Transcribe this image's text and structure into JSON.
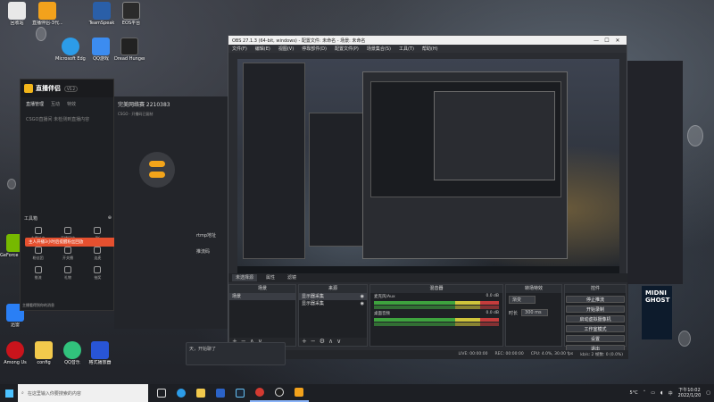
{
  "desktop_icons": [
    {
      "label": "回收站",
      "color": "#ffffff"
    },
    {
      "label": "直播伴侣-3代...",
      "color": "#f3a21c"
    },
    {
      "label": "TeamSpeak",
      "color": "#2a5fa8"
    },
    {
      "label": "EOS平台",
      "color": "#2b2b2b"
    },
    {
      "label": "Microsoft Edge",
      "color": "#2c9ce8"
    },
    {
      "label": "QQ游戏",
      "color": "#3c8cf0"
    },
    {
      "label": "Dread Hunger",
      "color": "#222222"
    },
    {
      "label": "GeForce Experience",
      "color": "#76b900"
    },
    {
      "label": "迅雷",
      "color": "#2a7ff5"
    },
    {
      "label": "Among Us",
      "color": "#c9141c"
    },
    {
      "label": "config",
      "color": "#f2c94c"
    },
    {
      "label": "QQ音乐",
      "color": "#31c27c"
    },
    {
      "label": "格式播放器",
      "color": "#2855d6"
    }
  ],
  "streaming_app": {
    "title": "直播伴侣",
    "version": "V5.2",
    "tabs": [
      "直播管理",
      "互动",
      "特效"
    ],
    "placeholder_text": "CSGO直播间  未检测到直播内容",
    "tools_title": "工具箱",
    "tools": [
      "主播任务",
      "直播回放",
      "PK",
      "粉丝团",
      "开关播",
      "连麦",
      "推流",
      "礼物",
      "抽奖"
    ],
    "banner_text": "主人开播3小时后提醒粉丝回放",
    "footer": "主播看得到你的消息"
  },
  "streaming_app_panel": {
    "room_title": "完美网络赛 2210383",
    "room_sub": "CSGO · 开播码已复制",
    "rtmp_label": "rtmp地址",
    "key_label": "推流码"
  },
  "obs": {
    "title": "OBS 27.1.3 (64-bit, windows) - 配置文件: 未命名 - 场景: 未命名",
    "window_buttons": [
      "—",
      "☐",
      "✕"
    ],
    "menu": [
      "文件(F)",
      "编辑(E)",
      "视图(V)",
      "停靠部件(D)",
      "配置文件(P)",
      "场景集合(S)",
      "工具(T)",
      "帮助(H)"
    ],
    "tabs": [
      "未选择源",
      "属性",
      "滤镜"
    ],
    "scenes_header": "场景",
    "scenes": [
      "场景"
    ],
    "sources_header": "来源",
    "sources": [
      "显示器采集",
      "显示器采集"
    ],
    "mixer_header": "混音器",
    "mixer": [
      {
        "name": "桌面音频",
        "db": "0.0 dB"
      },
      {
        "name": "麦克风/Aux",
        "db": "0.0 dB"
      }
    ],
    "transitions_header": "转场特效",
    "transition_type": "渐变",
    "duration_label": "时长",
    "duration_value": "300 ms",
    "controls_header": "控件",
    "controls": [
      "停止推流",
      "开始录制",
      "启动虚拟摄像机",
      "工作室模式",
      "设置",
      "退出"
    ],
    "status": [
      "LIVE: 00:00:00",
      "REC: 00:00:00",
      "CPU: 4.0%, 30.00 fps",
      "kb/s: 2 帧数: 0 (0.0%)"
    ]
  },
  "chat": {
    "text": "天，开始聊了"
  },
  "promo": {
    "text": "MIDNI GHOST"
  },
  "taskbar": {
    "search_placeholder": "在这里输入你要搜索的内容",
    "temperature": "5°C",
    "ime": "中",
    "time": "下午10:02",
    "date": "2022/1/20"
  }
}
